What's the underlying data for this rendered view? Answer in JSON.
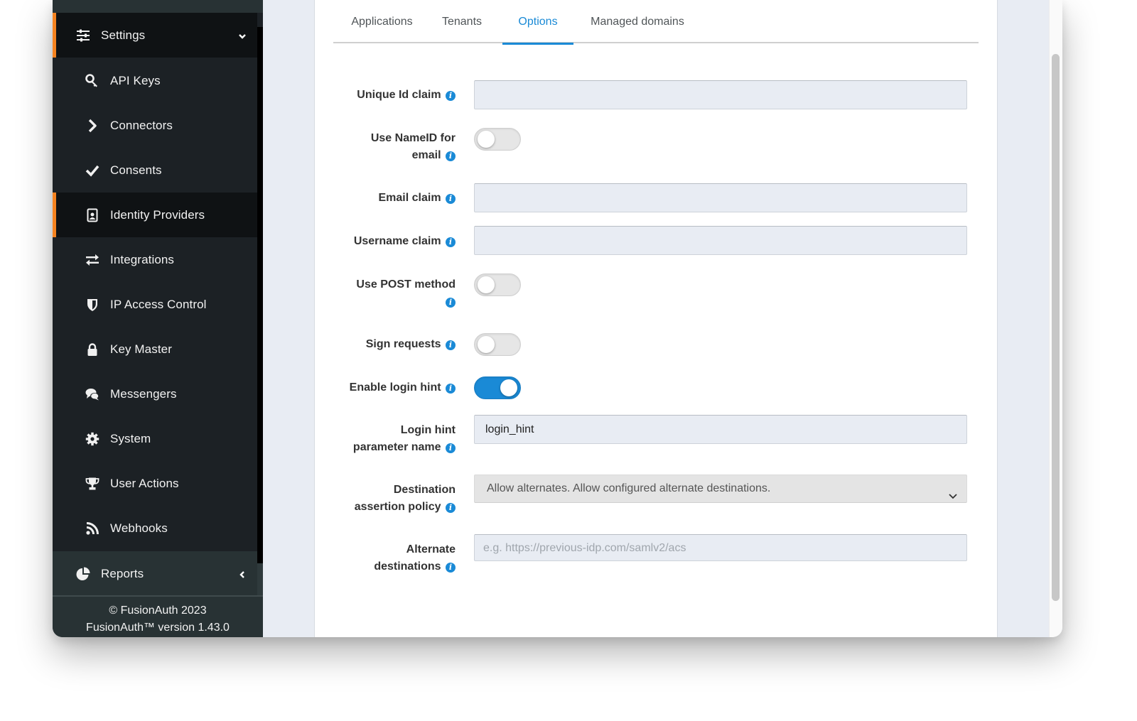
{
  "sidebar": {
    "settings": {
      "label": "Settings",
      "icon": "sliders-icon"
    },
    "items": [
      {
        "label": "API Keys",
        "icon": "key-icon"
      },
      {
        "label": "Connectors",
        "icon": "chevron-right-icon"
      },
      {
        "label": "Consents",
        "icon": "check-icon"
      },
      {
        "label": "Identity Providers",
        "icon": "id-badge-icon",
        "active": true
      },
      {
        "label": "Integrations",
        "icon": "exchange-icon"
      },
      {
        "label": "IP Access Control",
        "icon": "shield-icon"
      },
      {
        "label": "Key Master",
        "icon": "lock-icon"
      },
      {
        "label": "Messengers",
        "icon": "comments-icon"
      },
      {
        "label": "System",
        "icon": "gear-icon"
      },
      {
        "label": "User Actions",
        "icon": "trophy-icon"
      },
      {
        "label": "Webhooks",
        "icon": "rss-icon"
      }
    ],
    "reports": {
      "label": "Reports",
      "icon": "pie-chart-icon"
    },
    "footer": {
      "copyright": "© FusionAuth 2023",
      "version": "FusionAuth™ version 1.43.0"
    }
  },
  "tabs": [
    {
      "label": "Applications"
    },
    {
      "label": "Tenants"
    },
    {
      "label": "Options",
      "active": true
    },
    {
      "label": "Managed domains"
    }
  ],
  "form": {
    "unique_id_claim": {
      "label": "Unique Id claim",
      "value": ""
    },
    "use_nameid_for_email": {
      "label_line1": "Use NameID for",
      "label_line2": "email",
      "enabled": false
    },
    "email_claim": {
      "label": "Email claim",
      "value": ""
    },
    "username_claim": {
      "label": "Username claim",
      "value": ""
    },
    "use_post_method": {
      "label": "Use POST method",
      "enabled": false
    },
    "sign_requests": {
      "label": "Sign requests",
      "enabled": false
    },
    "enable_login_hint": {
      "label": "Enable login hint",
      "enabled": true
    },
    "login_hint_parameter_name": {
      "label_line1": "Login hint",
      "label_line2": "parameter name",
      "value": "login_hint"
    },
    "destination_assertion_policy": {
      "label_line1": "Destination",
      "label_line2": "assertion policy",
      "selected": "Allow alternates. Allow configured alternate destinations."
    },
    "alternate_destinations": {
      "label_line1": "Alternate",
      "label_line2": "destinations",
      "value": "",
      "placeholder": "e.g. https://previous-idp.com/samlv2/acs"
    },
    "info_glyph": "i"
  },
  "colors": {
    "accent": "#f58320",
    "primary": "#1a8ad6",
    "sidebar_bg": "#1c2125"
  }
}
